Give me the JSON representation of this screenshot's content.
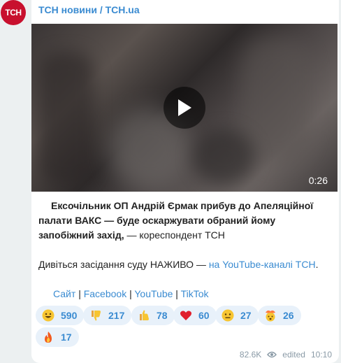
{
  "channel": {
    "name": "ТСН новини / TCH.ua",
    "avatar_text": "ТСН"
  },
  "video": {
    "duration": "0:26"
  },
  "caption": {
    "bold": "Ексочільник ОП Андрій Єрмак прибув до Апеляційної палати ВАКС — буде оскаржувати обраний йому запобіжний захід,",
    "rest": " — кореспондент ТСН"
  },
  "live": {
    "text": "Дивіться засідання суду НАЖИВО — ",
    "link": "на YouTube-каналі ТСН",
    "end": "."
  },
  "social": {
    "site": "Сайт",
    "facebook": "Facebook",
    "youtube": "YouTube",
    "tiktok": "TikTok",
    "sep": "|"
  },
  "reactions": [
    {
      "icon": "grinning-face-icon",
      "count": "590"
    },
    {
      "icon": "thumbs-down-icon",
      "count": "217"
    },
    {
      "icon": "thumbs-up-icon",
      "count": "78"
    },
    {
      "icon": "red-heart-icon",
      "count": "60"
    },
    {
      "icon": "neutral-face-icon",
      "count": "27"
    },
    {
      "icon": "exploding-head-icon",
      "count": "26"
    },
    {
      "icon": "fire-icon",
      "count": "17"
    }
  ],
  "meta": {
    "views": "82.6K",
    "edited": "edited",
    "time": "10:10"
  },
  "colors": {
    "accent": "#3a8bd1",
    "brand": "#c8102e",
    "reaction_bg": "#e8f1fa"
  }
}
